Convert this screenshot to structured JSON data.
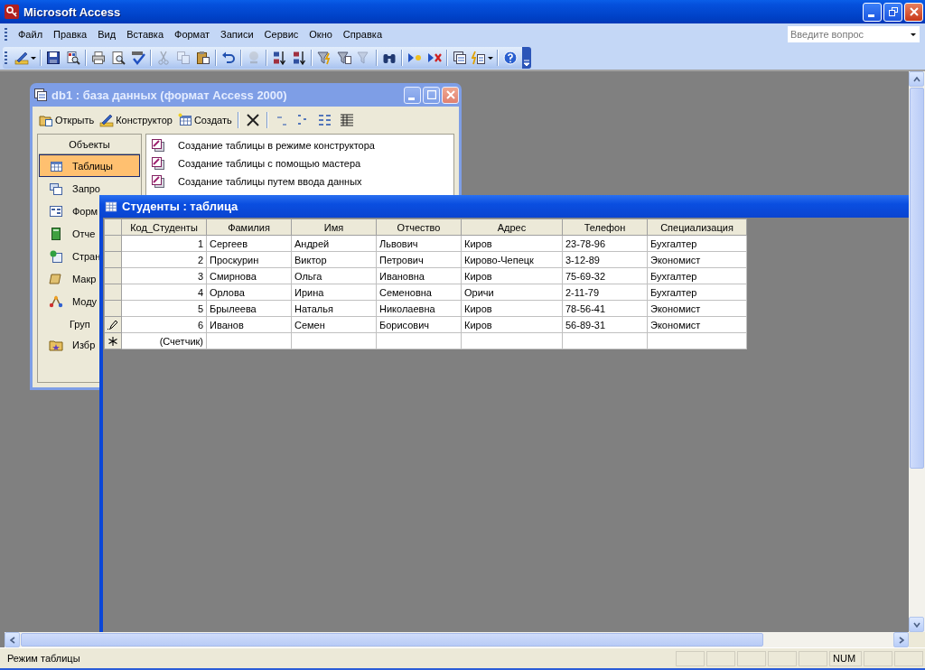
{
  "window": {
    "title": "Microsoft Access"
  },
  "menu": [
    "Файл",
    "Правка",
    "Вид",
    "Вставка",
    "Формат",
    "Записи",
    "Сервис",
    "Окно",
    "Справка"
  ],
  "help_box": {
    "placeholder": "Введите вопрос"
  },
  "toolbar": [
    {
      "disabled": false
    },
    {
      "disabled": false
    },
    {
      "disabled": false
    },
    {
      "disabled": false
    },
    {
      "disabled": false
    },
    {
      "disabled": false
    },
    {
      "disabled": true
    },
    {
      "disabled": true
    },
    {
      "disabled": false
    },
    {
      "disabled": false
    },
    {
      "disabled": true
    },
    {
      "disabled": false
    },
    {
      "disabled": false
    },
    {
      "disabled": false
    },
    {
      "disabled": false
    },
    {
      "disabled": true
    },
    {
      "disabled": false
    },
    {
      "disabled": false
    },
    {
      "disabled": false
    },
    {
      "disabled": false
    },
    {
      "disabled": false
    },
    {
      "disabled": false
    }
  ],
  "db_window": {
    "title": "db1 : база данных (формат Access 2000)",
    "actions": [
      "Открыть",
      "Конструктор",
      "Создать"
    ],
    "objects_header": "Объекты",
    "objects": [
      {
        "label": "Таблицы",
        "selected": true
      },
      {
        "label": "Запро",
        "selected": false
      },
      {
        "label": "Форм",
        "selected": false
      },
      {
        "label": "Отче",
        "selected": false
      },
      {
        "label": "Стран",
        "selected": false
      },
      {
        "label": "Макр",
        "selected": false
      },
      {
        "label": "Моду",
        "selected": false
      }
    ],
    "groups_header": "Груп",
    "groups": [
      {
        "label": "Избр",
        "selected": false
      }
    ],
    "items": [
      "Создание таблицы в режиме конструктора",
      "Создание таблицы с помощью мастера",
      "Создание таблицы путем ввода данных"
    ]
  },
  "table_window": {
    "title": "Студенты : таблица",
    "columns": [
      "Код_Студенты",
      "Фамилия",
      "Имя",
      "Отчество",
      "Адрес",
      "Телефон",
      "Специализация"
    ],
    "rows": [
      {
        "editing": false,
        "cells": [
          "1",
          "Сергеев",
          "Андрей",
          "Львович",
          "Киров",
          "23-78-96",
          "Бухгалтер"
        ]
      },
      {
        "editing": false,
        "cells": [
          "2",
          "Проскурин",
          "Виктор",
          "Петрович",
          "Кирово-Чепецк",
          "3-12-89",
          "Экономист"
        ]
      },
      {
        "editing": false,
        "cells": [
          "3",
          "Смирнова",
          "Ольга",
          "Ивановна",
          "Киров",
          "75-69-32",
          "Бухгалтер"
        ]
      },
      {
        "editing": false,
        "cells": [
          "4",
          "Орлова",
          "Ирина",
          "Семеновна",
          "Оричи",
          "2-11-79",
          "Бухгалтер"
        ]
      },
      {
        "editing": false,
        "cells": [
          "5",
          "Брылеева",
          "Наталья",
          "Николаевна",
          "Киров",
          "78-56-41",
          "Экономист"
        ]
      },
      {
        "editing": true,
        "cells": [
          "6",
          "Иванов",
          "Семен",
          "Борисович",
          "Киров",
          "56-89-31",
          "Экономист"
        ]
      }
    ],
    "new_row": {
      "counter": "(Счетчик)"
    }
  },
  "status_bar": {
    "message": "Режим таблицы",
    "indicators": [
      "NUM"
    ]
  }
}
